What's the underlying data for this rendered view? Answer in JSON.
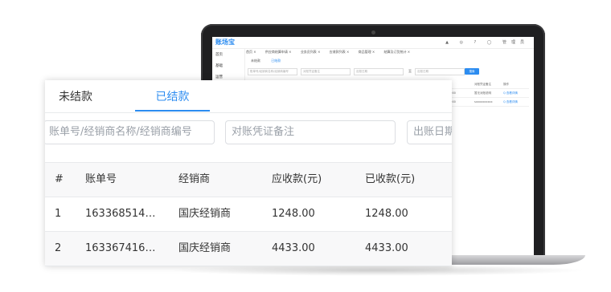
{
  "screen": {
    "logo": "账场宝",
    "top_icons": "▲ ◎ ? ◯ 管理员",
    "sidebar": [
      "首页",
      "基础",
      "运营"
    ],
    "tabs": [
      "首页 ×",
      "供应商结算申请 ×",
      "业务员列表 ×",
      "应收款列表 ×",
      "商品管理 ×",
      "结算及订货统计 ×"
    ],
    "subtabs": [
      "未结款",
      "已结款"
    ],
    "filters": [
      "账单号/经销商名称/经销商编号",
      "对账凭证备注",
      "出账日期",
      "至",
      "出账日期"
    ],
    "search_label": "搜索",
    "grid_rows": [
      {
        "a": "",
        "b": "",
        "c": "对账凭证备注",
        "d": "操作"
      },
      {
        "a": "",
        "b": "3000",
        "c": "暂无对账说明",
        "d": "Q 查看详情"
      },
      {
        "a": "",
        "b": "3000",
        "c": "sxxxxxxxxxx",
        "d": "Q 查看详情"
      }
    ]
  },
  "panel": {
    "tabs": {
      "unpaid": "未结款",
      "paid": "已结款"
    },
    "filters": {
      "bill_search_placeholder": "账单号/经销商名称/经销商编号",
      "remark_placeholder": "对账凭证备注",
      "date_placeholder": "出账日期"
    },
    "table": {
      "headers": [
        "#",
        "账单号",
        "经销商",
        "应收款(元)",
        "已收款(元)"
      ],
      "rows": [
        {
          "index": "1",
          "bill_no": "16336851419...",
          "dealer": "国庆经销商",
          "receivable": "1248.00",
          "received": "1248.00"
        },
        {
          "index": "2",
          "bill_no": "16336741654...",
          "dealer": "国庆经销商",
          "receivable": "4433.00",
          "received": "4433.00"
        }
      ]
    }
  },
  "colors": {
    "accent": "#2c8cf0",
    "text": "#333333",
    "placeholder": "#9aa0a8",
    "header_bg": "#f8f8f9"
  }
}
